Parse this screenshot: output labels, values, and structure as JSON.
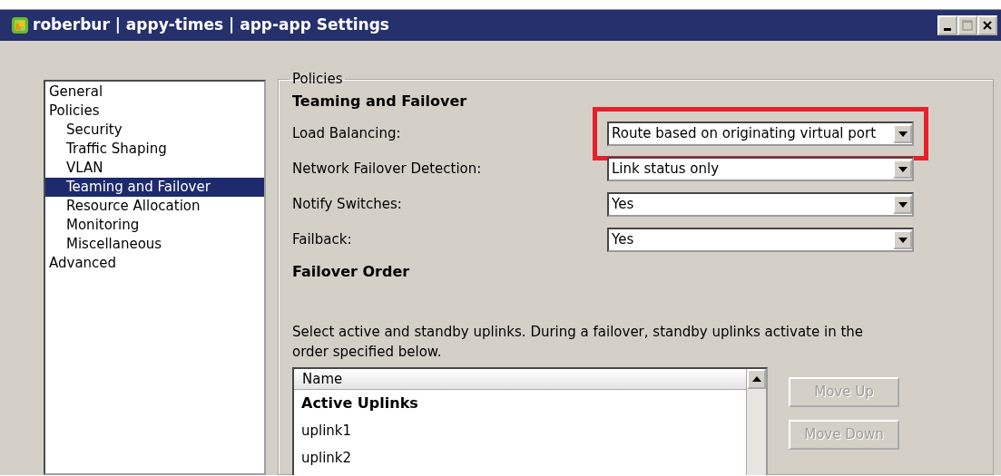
{
  "window": {
    "title": "roberbur | appy-times | app-app Settings"
  },
  "tree": [
    {
      "label": "General",
      "selected": false
    },
    {
      "label": "Policies",
      "selected": false,
      "children": [
        {
          "label": "Security",
          "selected": false
        },
        {
          "label": "Traffic Shaping",
          "selected": false
        },
        {
          "label": "VLAN",
          "selected": false
        },
        {
          "label": "Teaming and Failover",
          "selected": true
        },
        {
          "label": "Resource Allocation",
          "selected": false
        },
        {
          "label": "Monitoring",
          "selected": false
        },
        {
          "label": "Miscellaneous",
          "selected": false
        }
      ]
    },
    {
      "label": "Advanced",
      "selected": false
    }
  ],
  "group": {
    "legend": "Policies",
    "heading": "Teaming and Failover",
    "settings": [
      {
        "label": "Load Balancing:",
        "value": "Route based on originating virtual port",
        "highlighted": true
      },
      {
        "label": "Network Failover Detection:",
        "value": "Link status only",
        "highlighted": false
      },
      {
        "label": "Notify Switches:",
        "value": "Yes",
        "highlighted": false
      },
      {
        "label": "Failback:",
        "value": "Yes",
        "highlighted": false
      }
    ],
    "order_heading": "Failover Order",
    "description": "Select active and standby uplinks. During a failover, standby uplinks activate in the order specified below.",
    "uplinks": {
      "column": "Name",
      "rows": [
        {
          "label": "Active Uplinks",
          "kind": "group"
        },
        {
          "label": "uplink1",
          "kind": "item"
        },
        {
          "label": "uplink2",
          "kind": "item"
        }
      ]
    },
    "buttons": [
      {
        "label": "Move Up",
        "disabled": true
      },
      {
        "label": "Move Down",
        "disabled": true
      }
    ]
  }
}
